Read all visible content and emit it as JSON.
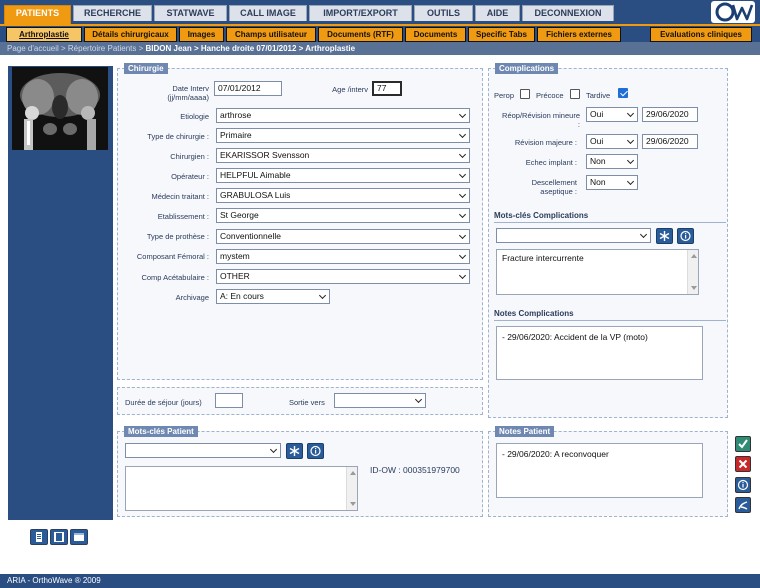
{
  "nav": {
    "main_tabs": [
      "PATIENTS",
      "RECHERCHE",
      "STATWAVE",
      "CALL IMAGE",
      "IMPORT/EXPORT",
      "OUTILS",
      "AIDE",
      "DECONNEXION"
    ],
    "sub_tabs": [
      "Arthroplastie",
      "Détails chirurgicaux",
      "Images",
      "Champs utilisateur",
      "Documents (RTF)",
      "Documents",
      "Specific Tabs",
      "Fichiers externes",
      "Evaluations cliniques"
    ],
    "logo_text": "OW"
  },
  "breadcrumb": {
    "trail": "Page d'accueil > Répertoire Patients > ",
    "current": "BIDON Jean > Hanche droite 07/01/2012 > Arthroplastie"
  },
  "chirurgie": {
    "legend": "Chirurgie",
    "date_label_1": "Date Interv",
    "date_label_2": "(jj/mm/aaaa)",
    "date_value": "07/01/2012",
    "age_label": "Age /interv",
    "age_value": "77",
    "fields": [
      {
        "label": "Etiologie",
        "value": "arthrose"
      },
      {
        "label": "Type de chirurgie :",
        "value": "Primaire"
      },
      {
        "label": "Chirurgien :",
        "value": "EKARISSOR Svensson"
      },
      {
        "label": "Opérateur :",
        "value": "HELPFUL Aimable"
      },
      {
        "label": "Médecin traitant :",
        "value": "GRABULOSA Luis"
      },
      {
        "label": "Etablissement :",
        "value": "St George"
      },
      {
        "label": "Type de prothèse :",
        "value": "Conventionnelle"
      },
      {
        "label": "Composant Fémoral :",
        "value": "mystem"
      },
      {
        "label": "Comp Acétabulaire :",
        "value": "OTHER"
      }
    ],
    "archivage_label": "Archivage",
    "archivage_value": "A: En cours"
  },
  "sejour": {
    "duree_label": "Durée de séjour (jours)",
    "duree_value": "",
    "sortie_label": "Sortie vers",
    "sortie_value": ""
  },
  "complications": {
    "legend": "Complications",
    "perop_label": "Perop",
    "precoce_label": "Précoce",
    "tardive_label": "Tardive",
    "checks": {
      "perop": false,
      "precoce": false,
      "tardive": true
    },
    "reop_label_1": "Réop/Révision mineure",
    "reop_label_2": ":",
    "reop_value": "Oui",
    "reop_date": "29/06/2020",
    "revision_label": "Révision majeure :",
    "revision_value": "Oui",
    "revision_date": "29/06/2020",
    "echec_label": "Echec implant :",
    "echec_value": "Non",
    "descellement_label_1": "Descellement",
    "descellement_label_2": "aseptique :",
    "descellement_value": "Non",
    "mots_cles_title": "Mots-clés Complications",
    "mots_cles_select": "",
    "mots_cles_list": "Fracture intercurrente",
    "notes_title": "Notes Complications",
    "notes_text": "- 29/06/2020: Accident de la VP (moto)"
  },
  "mots_cles_patient": {
    "legend": "Mots-clés Patient",
    "select_value": "",
    "list_text": "",
    "id_label": "ID-OW : 000351979700"
  },
  "notes_patient": {
    "legend": "Notes Patient",
    "text": "- 29/06/2020: A reconvoquer"
  },
  "footer": {
    "text": "ARIA - OrthoWave ® 2009"
  },
  "colors": {
    "nav_blue": "#2a4d82",
    "accent_orange": "#f09a12",
    "confirm_green": "#2f8b74",
    "cancel_red": "#c8282a"
  },
  "icons": [
    "asterisk-icon",
    "info-icon",
    "checkmark-icon",
    "cross-icon",
    "help-icon",
    "pdf-icon",
    "document-icon",
    "film-icon",
    "window-icon"
  ]
}
